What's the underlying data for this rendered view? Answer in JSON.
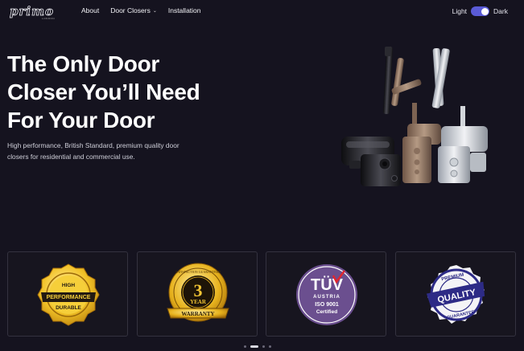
{
  "brand": {
    "logo_text": "primo",
    "logo_sub": "LONDON"
  },
  "nav": {
    "items": [
      "About",
      "Door Closers",
      "Installation"
    ],
    "dropdown_index": 1
  },
  "theme_toggle": {
    "light_label": "Light",
    "dark_label": "Dark",
    "selected": "Dark"
  },
  "hero": {
    "title_lines": [
      "The Only Door",
      "Closer You’ll Need",
      "For Your Door"
    ],
    "subtitle_lines": [
      "High performance, British Standard, premium quality door",
      "closers for residential and commercial use."
    ]
  },
  "badges": {
    "performance": {
      "line1": "HIGH",
      "line2": "PERFORMANCE",
      "line3": "DURABLE"
    },
    "warranty": {
      "number": "3",
      "year": "YEAR",
      "ribbon": "WARRANTY",
      "arc": "SATISFACTION GUARANTEED"
    },
    "tuv": {
      "mark": "TÜV",
      "country": "AUSTRIA",
      "iso": "ISO 9001",
      "cert": "Certified"
    },
    "quality": {
      "top": "PREMIUM",
      "main": "QUALITY",
      "bottom": "GUARANTEE"
    }
  },
  "pager": {
    "count": 4,
    "active": 1
  },
  "colors": {
    "background": "#15131f",
    "toggle": "#5a5bd6",
    "gold": "#e6b422",
    "tuv_purple": "#6b4f8f",
    "quality_blue": "#2d2b86"
  }
}
